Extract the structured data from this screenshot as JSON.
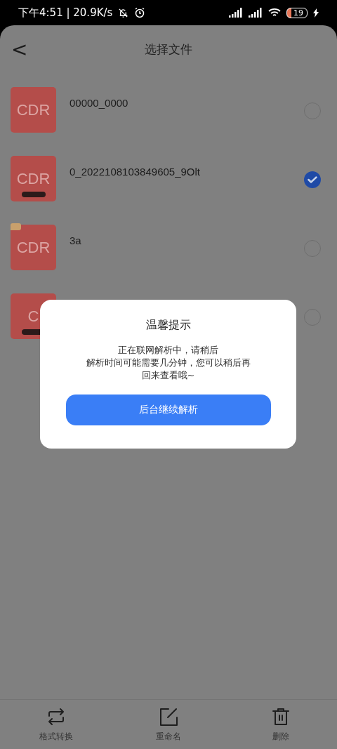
{
  "status_bar": {
    "time": "下午4:51 | 20.9K/s",
    "battery": "19"
  },
  "header": {
    "back": "<",
    "title": "选择文件"
  },
  "files": [
    {
      "thumb": "CDR",
      "name": "00000_0000",
      "selected": false,
      "kind": "plain"
    },
    {
      "thumb": "CDR",
      "name": "0_2022108103849605_9Olt",
      "selected": true,
      "kind": "status"
    },
    {
      "thumb": "CDR",
      "name": "3a",
      "selected": false,
      "kind": "vip"
    },
    {
      "thumb": "C",
      "selected": false,
      "kind": "status"
    }
  ],
  "dialog": {
    "title": "温馨提示",
    "message_lines": [
      "正在联网解析中，请稍后",
      "解析时间可能需要几分钟，您可以稍后再",
      "回来查看哦~"
    ],
    "button": "后台继续解析"
  },
  "toolbar": [
    {
      "kind": "convert",
      "label": "格式转换"
    },
    {
      "kind": "rename",
      "label": "重命名"
    },
    {
      "kind": "delete",
      "label": "删除"
    }
  ]
}
